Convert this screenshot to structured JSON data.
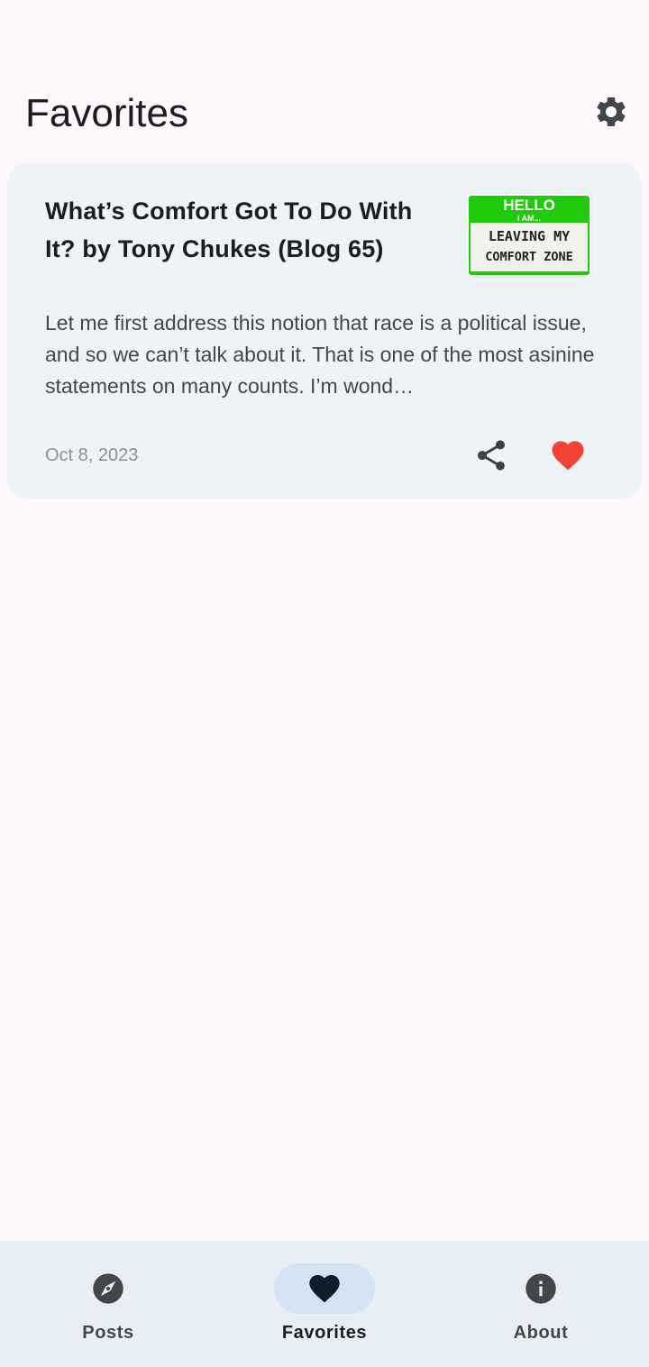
{
  "header": {
    "title": "Favorites",
    "settings_icon": "gear-icon"
  },
  "favorites": [
    {
      "title": "What’s Comfort Got To Do With It? by Tony Chukes (Blog 65)",
      "thumbnail": {
        "line1": "HELLO",
        "line2": "I AM...",
        "line3": "LEAVING MY",
        "line4": "COMFORT ZONE"
      },
      "excerpt": "Let me first address this notion that race is a political issue, and so we can’t talk about it.  That is one of the most asinine statements on many counts.  I’m wond…",
      "date": "Oct 8, 2023",
      "share_icon": "share-icon",
      "favorite_icon": "heart-icon",
      "favorite_color": "#f44336"
    }
  ],
  "nav": {
    "items": [
      {
        "label": "Posts",
        "icon": "compass-icon",
        "active": false
      },
      {
        "label": "Favorites",
        "icon": "heart-icon",
        "active": true
      },
      {
        "label": "About",
        "icon": "info-icon",
        "active": false
      }
    ]
  },
  "colors": {
    "background": "#fef8fd",
    "card": "#eef3f7",
    "nav_bar": "#e7eef5",
    "nav_active_pill": "#d3e3f4",
    "favorite": "#f44336",
    "thumb_green": "#1fcb0a"
  }
}
